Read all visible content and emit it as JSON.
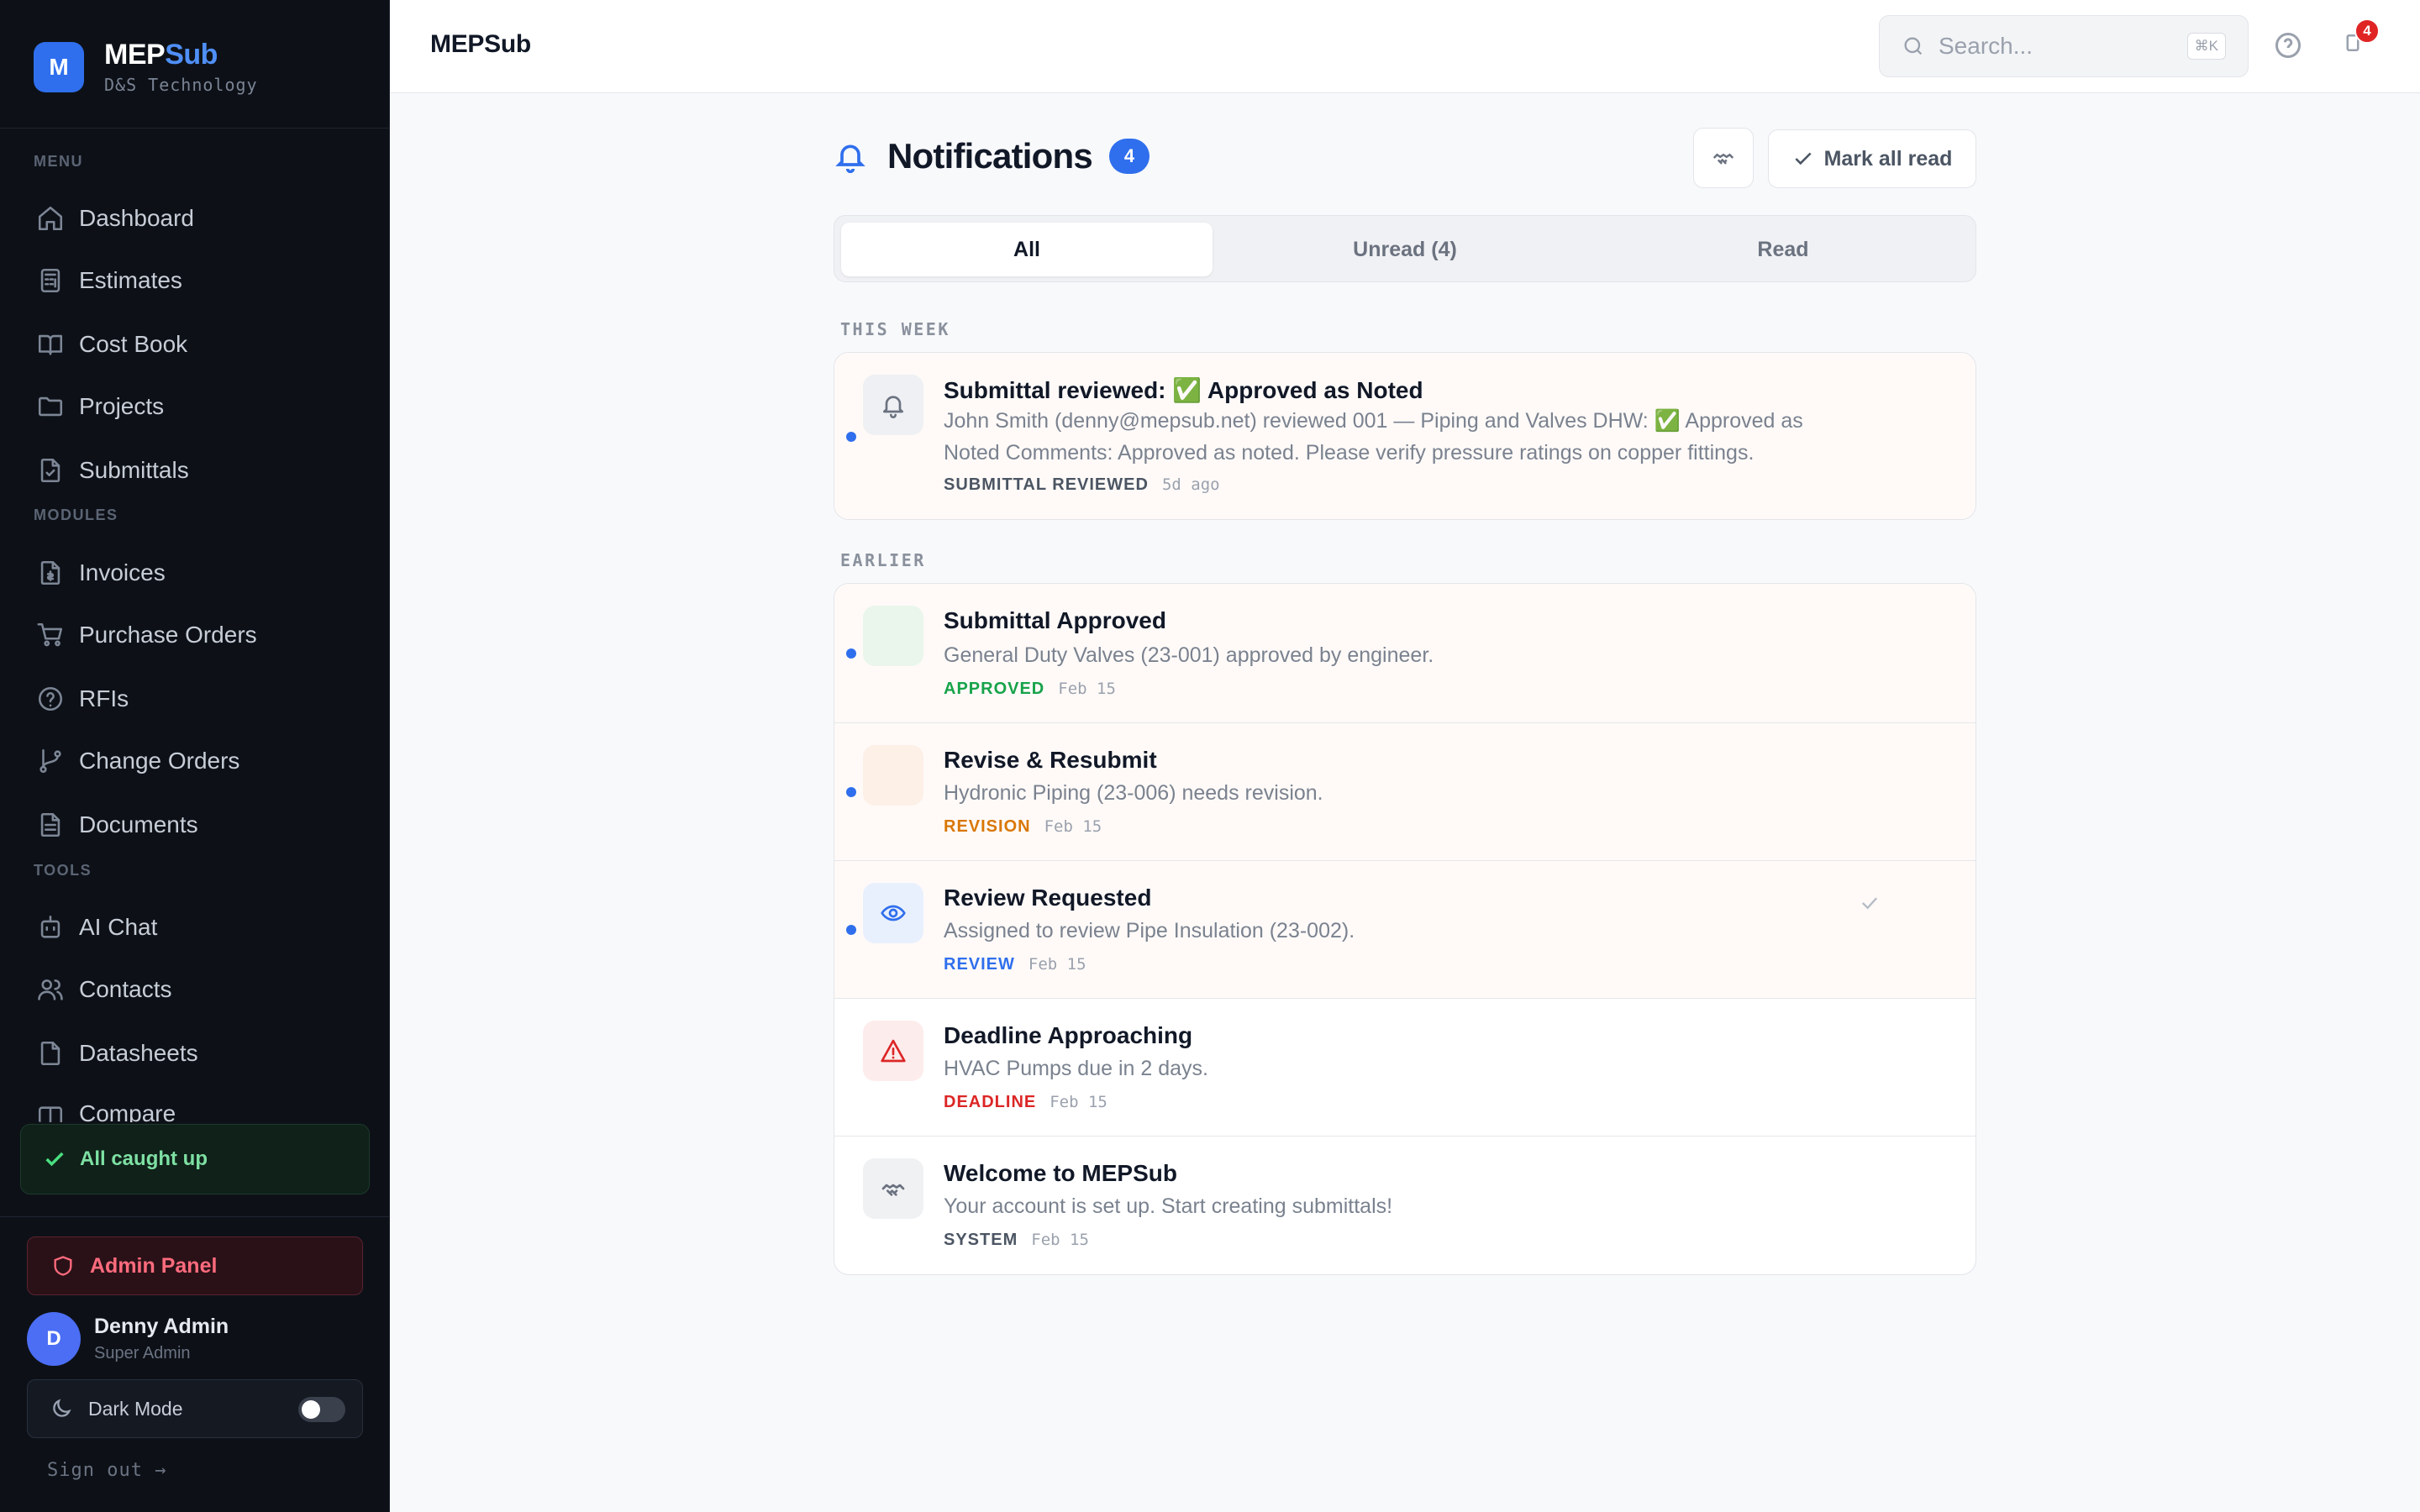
{
  "app": {
    "brand_first": "MEP",
    "brand_second": "Sub",
    "brand_logo_letter": "M",
    "company": "D&S Technology",
    "page_title": "MEPSub"
  },
  "sidebar": {
    "sections": {
      "menu": "MENU",
      "modules": "MODULES",
      "tools": "TOOLS"
    },
    "menu_items": [
      {
        "label": "Dashboard",
        "icon": "home-icon"
      },
      {
        "label": "Estimates",
        "icon": "calculator-icon"
      },
      {
        "label": "Cost Book",
        "icon": "book-icon"
      },
      {
        "label": "Projects",
        "icon": "folder-icon"
      },
      {
        "label": "Submittals",
        "icon": "file-check-icon"
      }
    ],
    "module_items": [
      {
        "label": "Invoices",
        "icon": "invoice-icon"
      },
      {
        "label": "Purchase Orders",
        "icon": "cart-icon"
      },
      {
        "label": "RFIs",
        "icon": "question-circle-icon"
      },
      {
        "label": "Change Orders",
        "icon": "git-branch-icon"
      },
      {
        "label": "Documents",
        "icon": "document-icon"
      }
    ],
    "tool_items": [
      {
        "label": "AI Chat",
        "icon": "bot-icon"
      },
      {
        "label": "Contacts",
        "icon": "users-icon"
      },
      {
        "label": "Datasheets",
        "icon": "file-icon"
      },
      {
        "label": "Compare",
        "icon": "compare-icon"
      }
    ],
    "caught_up": "All caught up",
    "admin_panel": "Admin Panel",
    "user": {
      "initial": "D",
      "name": "Denny Admin",
      "role": "Super Admin"
    },
    "dark_mode_label": "Dark Mode",
    "dark_mode_on": false,
    "sign_out": "Sign out →"
  },
  "topbar": {
    "search_placeholder": "Search...",
    "search_shortcut": "⌘K",
    "notification_badge": "4"
  },
  "notifications": {
    "title": "Notifications",
    "count": "4",
    "mark_all_read": "Mark all read",
    "tabs": [
      {
        "label": "All",
        "active": true
      },
      {
        "label": "Unread (4)",
        "active": false
      },
      {
        "label": "Read",
        "active": false
      }
    ],
    "groups": {
      "this_week": "THIS WEEK",
      "earlier": "EARLIER"
    },
    "this_week": [
      {
        "title": "Submittal reviewed: ✅ Approved as Noted",
        "body": "John Smith (denny@mepsub.net) reviewed 001 — Piping and Valves DHW: ✅ Approved as Noted Comments: Approved as noted. Please verify pressure ratings on copper fittings.",
        "tag": "SUBMITTAL REVIEWED",
        "time": "5d ago",
        "icon": "bell-icon",
        "unread": true
      }
    ],
    "earlier": [
      {
        "title": "Submittal Approved",
        "body": "General Duty Valves (23-001) approved by engineer.",
        "tag": "APPROVED",
        "time": "Feb 15",
        "icon": "blank-icon",
        "unread": true
      },
      {
        "title": "Revise & Resubmit",
        "body": "Hydronic Piping (23-006) needs revision.",
        "tag": "REVISION",
        "time": "Feb 15",
        "icon": "blank-icon",
        "unread": true
      },
      {
        "title": "Review Requested",
        "body": "Assigned to review Pipe Insulation (23-002).",
        "tag": "REVIEW",
        "time": "Feb 15",
        "icon": "eye-icon",
        "unread": true
      },
      {
        "title": "Deadline Approaching",
        "body": "HVAC Pumps due in 2 days.",
        "tag": "DEADLINE",
        "time": "Feb 15",
        "icon": "warning-icon",
        "unread": false
      },
      {
        "title": "Welcome to MEPSub",
        "body": "Your account is set up. Start creating submittals!",
        "tag": "SYSTEM",
        "time": "Feb 15",
        "icon": "handshake-icon",
        "unread": false
      }
    ]
  },
  "colors": {
    "accent": "#2f6fed",
    "approved": "#16a34a",
    "revision": "#d97706",
    "review": "#2f6fed",
    "deadline": "#dc2626",
    "system": "#4b5563",
    "danger": "#ff6b7d"
  }
}
